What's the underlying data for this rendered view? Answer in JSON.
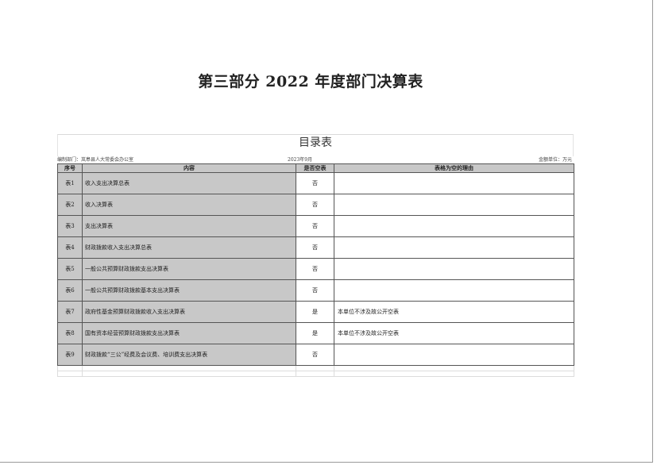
{
  "document": {
    "heading": "第三部分  2022 年度部门决算表"
  },
  "catalog": {
    "title": "目录表",
    "unit_label": "编制部门：岚皋县人大常委会办公室",
    "date_label": "2023年9月",
    "amount_unit": "金额单位：万元",
    "columns": {
      "seq": "序号",
      "content": "内容",
      "is_empty": "是否空表",
      "reason": "表格为空的理由"
    },
    "rows": [
      {
        "seq": "表1",
        "content": "收入支出决算总表",
        "is_empty": "否",
        "reason": ""
      },
      {
        "seq": "表2",
        "content": "收入决算表",
        "is_empty": "否",
        "reason": ""
      },
      {
        "seq": "表3",
        "content": "支出决算表",
        "is_empty": "否",
        "reason": ""
      },
      {
        "seq": "表4",
        "content": "财政拨款收入支出决算总表",
        "is_empty": "否",
        "reason": ""
      },
      {
        "seq": "表5",
        "content": "一般公共预算财政拨款支出决算表",
        "is_empty": "否",
        "reason": ""
      },
      {
        "seq": "表6",
        "content": "一般公共预算财政拨款基本支出决算表",
        "is_empty": "否",
        "reason": ""
      },
      {
        "seq": "表7",
        "content": "政府性基金预算财政拨款收入支出决算表",
        "is_empty": "是",
        "reason": "本单位不涉及故公开空表"
      },
      {
        "seq": "表8",
        "content": "国有资本经营预算财政拨款支出决算表",
        "is_empty": "是",
        "reason": "本单位不涉及故公开空表"
      },
      {
        "seq": "表9",
        "content": "财政拨款“三公”经费及会议费、培训费支出决算表",
        "is_empty": "否",
        "reason": ""
      }
    ]
  }
}
